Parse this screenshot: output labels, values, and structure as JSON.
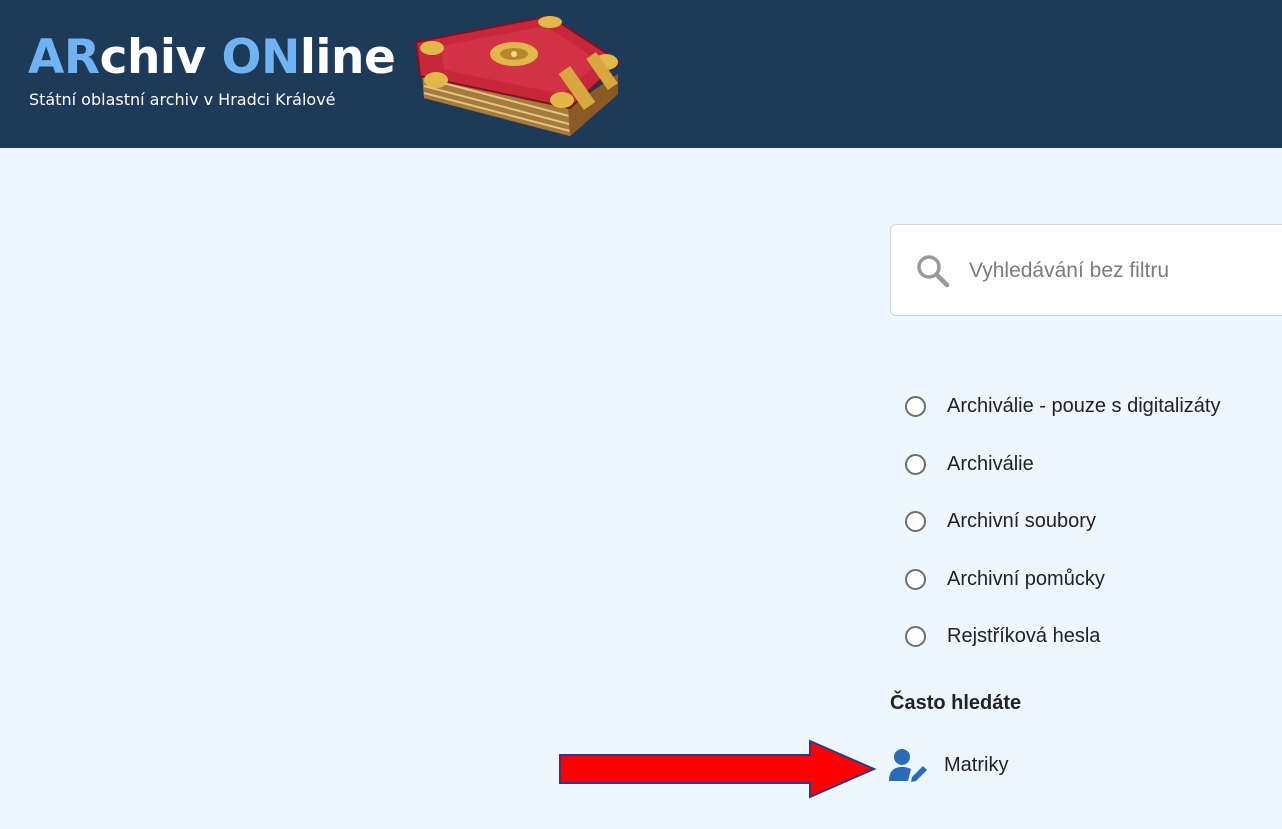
{
  "header": {
    "logo": {
      "part1": "AR",
      "part2": "chiv ",
      "part3": "ON",
      "part4": "line"
    },
    "subtitle": "Státní oblastní archiv v Hradci Králové",
    "image_icon": "old-book-icon"
  },
  "search": {
    "placeholder": "Vyhledávání bez filtru",
    "value": "",
    "icon": "search-icon"
  },
  "filters": [
    {
      "label": "Archiválie - pouze s digitalizáty",
      "selected": false
    },
    {
      "label": "Archiválie",
      "selected": false
    },
    {
      "label": "Archivní soubory",
      "selected": false
    },
    {
      "label": "Archivní pomůcky",
      "selected": false
    },
    {
      "label": "Rejstříková hesla",
      "selected": false
    }
  ],
  "frequent": {
    "title": "Často hledáte",
    "items": [
      {
        "label": "Matriky",
        "icon": "user-edit-icon"
      }
    ]
  },
  "annotation": {
    "icon": "red-arrow-icon"
  },
  "colors": {
    "header_bg": "#1d3a59",
    "logo_accent": "#6fb3f2",
    "page_bg": "#eef6fe",
    "link_icon": "#2b6cb8",
    "arrow": "#ff0000"
  }
}
